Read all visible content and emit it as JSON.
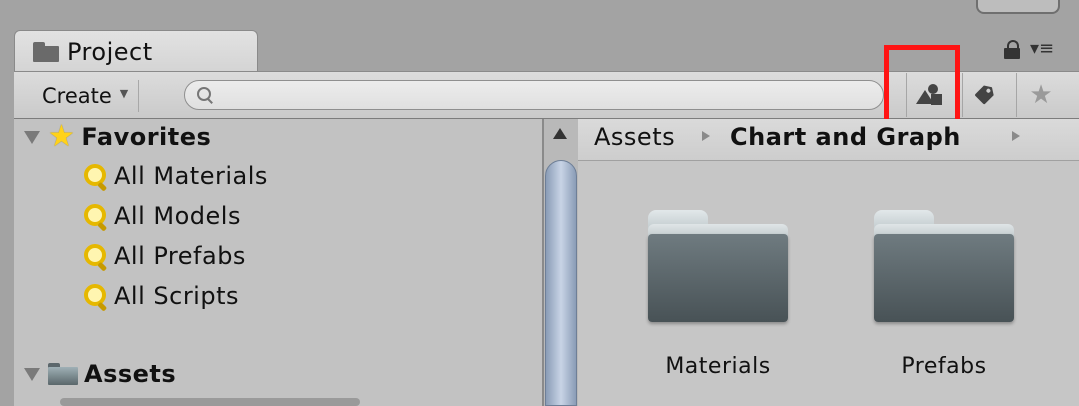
{
  "window": {
    "tab_title": "Project",
    "tab_icon": "folder-icon"
  },
  "toolbar": {
    "create_label": "Create",
    "search_value": "",
    "search_placeholder": "",
    "buttons": [
      "type-filter-icon",
      "label-filter-icon",
      "favorite-star-icon"
    ]
  },
  "sidebar": {
    "favorites": {
      "label": "Favorites",
      "items": [
        "All Materials",
        "All Models",
        "All Prefabs",
        "All Scripts"
      ]
    },
    "assets": {
      "label": "Assets"
    }
  },
  "breadcrumb": {
    "root": "Assets",
    "current": "Chart and Graph"
  },
  "assets_grid": [
    {
      "name": "Materials",
      "icon": "folder-icon"
    },
    {
      "name": "Prefabs",
      "icon": "folder-icon"
    }
  ],
  "colors": {
    "highlight": "#ff1414",
    "favorite_star": "#ffd21a"
  }
}
